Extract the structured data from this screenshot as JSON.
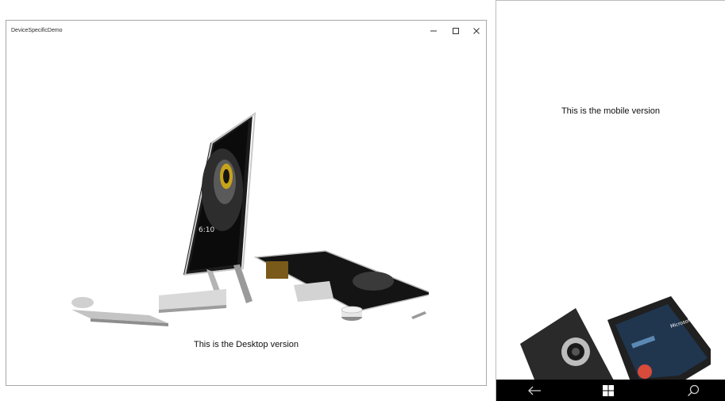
{
  "desktop_window": {
    "title": "DeviceSpecificDemo",
    "caption_buttons": {
      "minimize_icon": "minimize-icon",
      "maximize_icon": "maximize-icon",
      "close_icon": "close-icon"
    },
    "image": {
      "subject": "desktop-computer-photo",
      "screen_time": "6:10"
    },
    "caption": "This is the Desktop version"
  },
  "mobile": {
    "caption": "This is the mobile version",
    "image": {
      "subject": "phone-photo",
      "brand": "Microsoft"
    },
    "navbar": {
      "back_icon": "back-arrow-icon",
      "home_icon": "windows-logo-icon",
      "search_icon": "search-icon",
      "background": "#000000"
    }
  }
}
